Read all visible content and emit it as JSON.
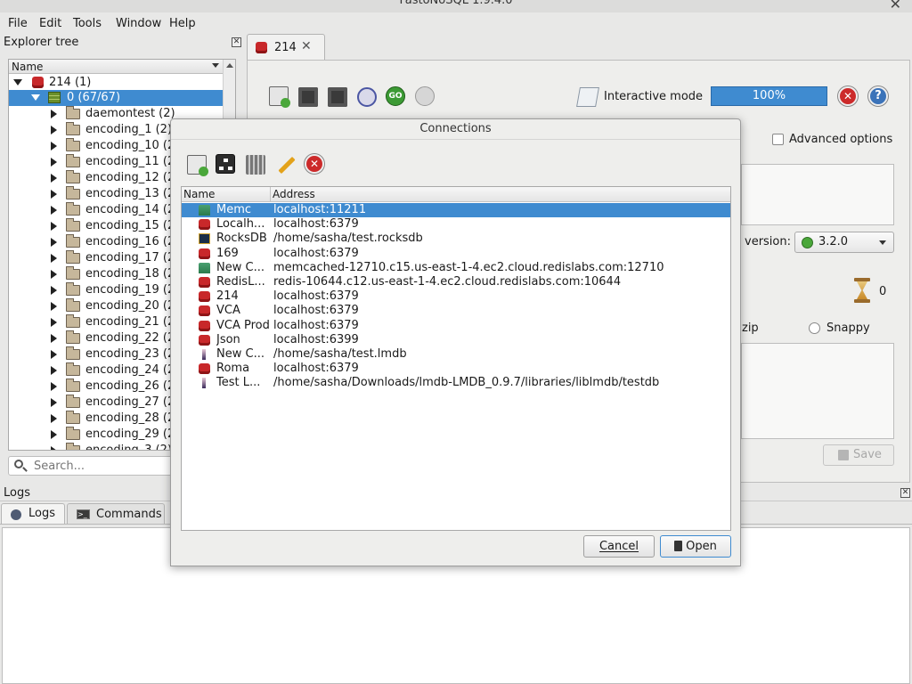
{
  "window": {
    "title": "FastoNoSQL 1.9.4.0"
  },
  "menu": [
    "File",
    "Edit",
    "Tools",
    "Window",
    "Help"
  ],
  "explorer": {
    "title": "Explorer tree",
    "column": "Name",
    "root": "214 (1)",
    "db": "0 (67/67)",
    "folders": [
      "daemontest (2)",
      "encoding_1 (2)",
      "encoding_10 (2",
      "encoding_11 (2",
      "encoding_12 (2",
      "encoding_13 (2",
      "encoding_14 (2",
      "encoding_15 (2",
      "encoding_16 (2",
      "encoding_17 (2",
      "encoding_18 (2",
      "encoding_19 (2",
      "encoding_20 (2",
      "encoding_21 (2",
      "encoding_22 (2",
      "encoding_23 (2",
      "encoding_24 (2",
      "encoding_26 (2",
      "encoding_27 (2",
      "encoding_28 (2",
      "encoding_29 (2",
      "encoding_3 (2)"
    ],
    "search_placeholder": "Search..."
  },
  "tab": {
    "label": "214"
  },
  "toolbar": {
    "interactive_mode": "Interactive mode",
    "progress": "100%",
    "progress_value": 100
  },
  "options": {
    "advanced": "Advanced options",
    "version_label": "version:",
    "version_value": "3.2.0",
    "count": "0",
    "gzip_fragment": "zip",
    "snappy": "Snappy",
    "save": "Save"
  },
  "logs": {
    "title": "Logs",
    "tabs": [
      "Logs",
      "Commands"
    ]
  },
  "dialog": {
    "title": "Connections",
    "columns": [
      "Name",
      "Address"
    ],
    "rows": [
      {
        "name": "Memc",
        "address": "localhost:11211",
        "type": "memc",
        "selected": true
      },
      {
        "name": "Localh...",
        "address": "localhost:6379",
        "type": "redis"
      },
      {
        "name": "RocksDB",
        "address": "/home/sasha/test.rocksdb",
        "type": "rocks"
      },
      {
        "name": "169",
        "address": "localhost:6379",
        "type": "redis"
      },
      {
        "name": "New C...",
        "address": "memcached-12710.c15.us-east-1-4.ec2.cloud.redislabs.com:12710",
        "type": "memc"
      },
      {
        "name": "RedisL...",
        "address": "redis-10644.c12.us-east-1-4.ec2.cloud.redislabs.com:10644",
        "type": "redis"
      },
      {
        "name": "214",
        "address": "localhost:6379",
        "type": "redis"
      },
      {
        "name": "VCA",
        "address": "localhost:6379",
        "type": "redis"
      },
      {
        "name": "VCA Prod",
        "address": "localhost:6379",
        "type": "redis"
      },
      {
        "name": "Json",
        "address": "localhost:6399",
        "type": "redis"
      },
      {
        "name": "New C...",
        "address": "/home/sasha/test.lmdb",
        "type": "lmdb"
      },
      {
        "name": "Roma",
        "address": "localhost:6379",
        "type": "redis"
      },
      {
        "name": "Test L...",
        "address": "/home/sasha/Downloads/lmdb-LMDB_0.9.7/libraries/liblmdb/testdb",
        "type": "lmdb"
      }
    ],
    "cancel": "Cancel",
    "open": "Open"
  }
}
